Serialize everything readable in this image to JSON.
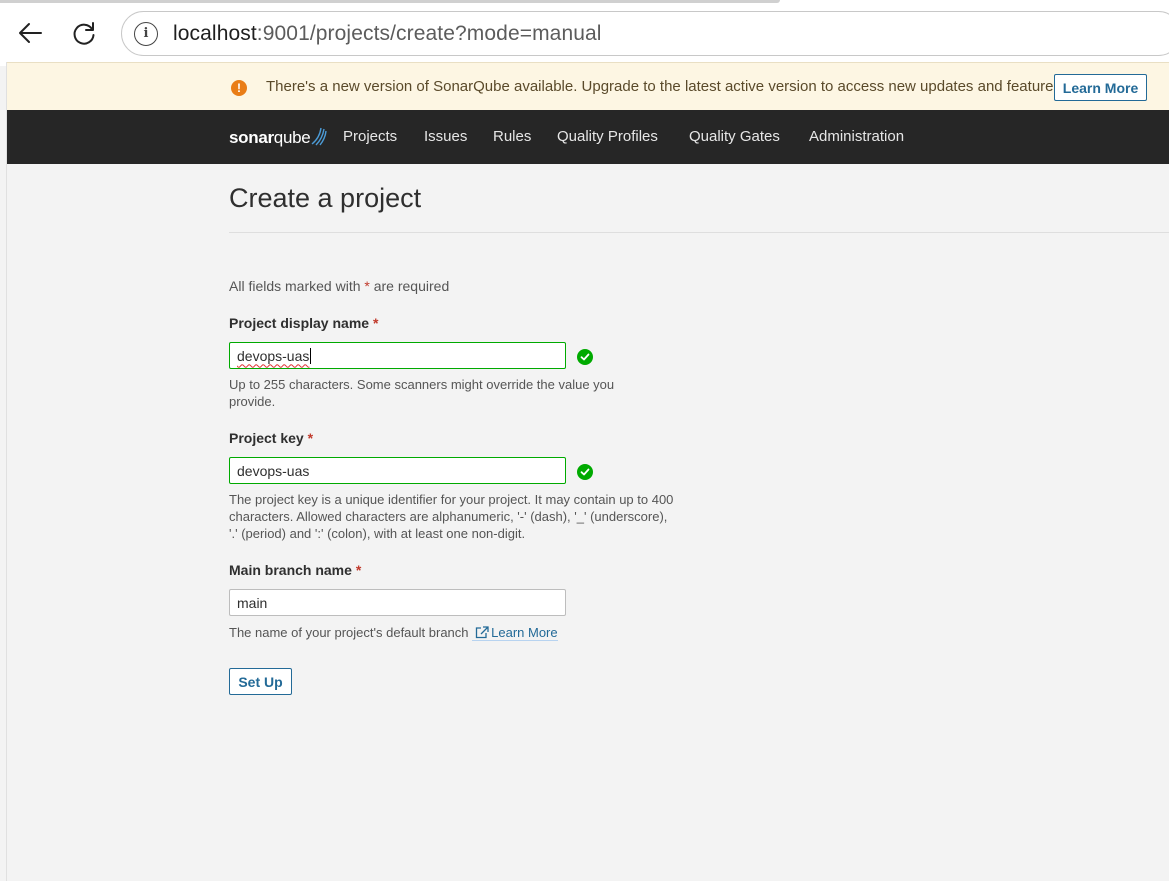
{
  "browser": {
    "url_host": "localhost",
    "url_rest": ":9001/projects/create?mode=manual"
  },
  "banner": {
    "message": "There's a new version of SonarQube available. Upgrade to the latest active version to access new updates and features.",
    "button_label": "Learn More"
  },
  "navbar": {
    "logo_bold": "sonar",
    "logo_rest": "qube",
    "items": [
      "Projects",
      "Issues",
      "Rules",
      "Quality Profiles",
      "Quality Gates",
      "Administration"
    ]
  },
  "main": {
    "title": "Create a project",
    "required_note_pre": "All fields marked with",
    "required_note_star": "*",
    "required_note_post": "are required",
    "display_name": {
      "label": "Project display name",
      "value": "devops-uas",
      "help": "Up to 255 characters. Some scanners might override the value you provide."
    },
    "project_key": {
      "label": "Project key",
      "value": "devops-uas",
      "help": "The project key is a unique identifier for your project. It may contain up to 400 characters. Allowed characters are alphanumeric, '-' (dash), '_' (underscore), '.' (period) and ':' (colon), with at least one non-digit."
    },
    "branch": {
      "label": "Main branch name",
      "value": "main",
      "help": "The name of your project's default branch",
      "link": "Learn More"
    },
    "setup_label": "Set Up"
  },
  "colors": {
    "accent": "#236a97",
    "valid": "#00aa00",
    "banner_bg": "#fdf6e3",
    "navbar_bg": "#262626",
    "required": "#c0392b"
  },
  "icons": {
    "back": "back-arrow-icon",
    "reload": "reload-icon",
    "info": "info-icon",
    "warning": "warning-icon",
    "check": "check-circle-icon",
    "external": "external-link-icon"
  }
}
